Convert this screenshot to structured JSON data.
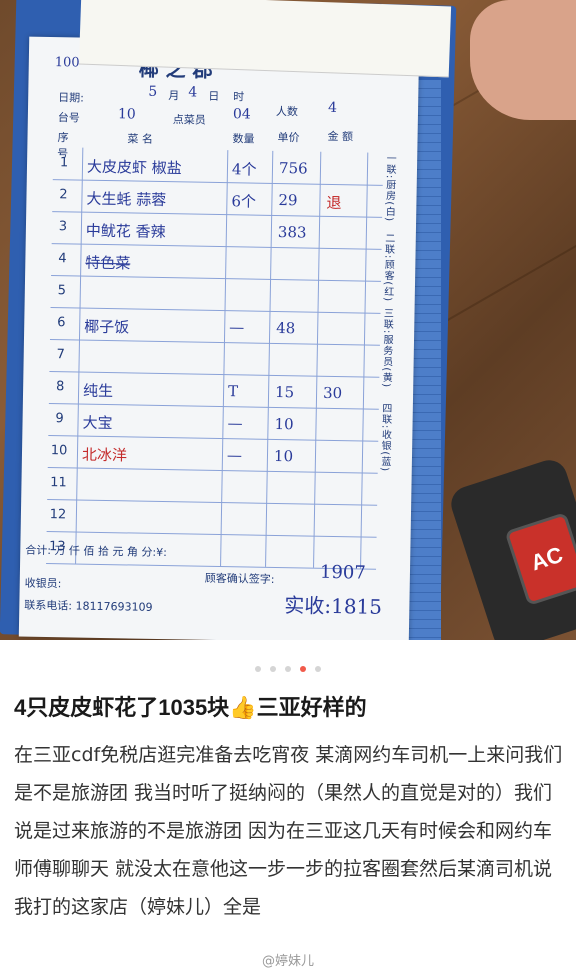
{
  "receipt": {
    "header_numbers": "100",
    "restaurant_title": "椰 之 郡",
    "date_label": "日期:",
    "month": "5",
    "day": "4",
    "month_unit": "月",
    "day_unit": "日",
    "hour_unit": "时",
    "table_label": "台号",
    "table_no": "10",
    "server_label": "点菜员",
    "server_no": "04",
    "guests_label": "人数",
    "guests": "4",
    "col_seq": "序号",
    "col_dish": "菜 名",
    "col_qty": "数量",
    "col_price": "单价",
    "col_amount": "金 额",
    "rows": [
      {
        "n": "1",
        "dish": "大皮皮虾 椒盐",
        "qty": "4个",
        "price": "756",
        "amount": ""
      },
      {
        "n": "2",
        "dish": "大生蚝 蒜蓉",
        "qty": "6个",
        "price": "29",
        "amount": "退"
      },
      {
        "n": "3",
        "dish": "中鱿花 香辣",
        "qty": "",
        "price": "383",
        "amount": ""
      },
      {
        "n": "4",
        "dish": "特色菜",
        "qty": "",
        "price": "",
        "amount": ""
      },
      {
        "n": "5",
        "dish": "",
        "qty": "",
        "price": "",
        "amount": ""
      },
      {
        "n": "6",
        "dish": "椰子饭",
        "qty": "—",
        "price": "48",
        "amount": ""
      },
      {
        "n": "7",
        "dish": "",
        "qty": "",
        "price": "",
        "amount": ""
      },
      {
        "n": "8",
        "dish": "纯生",
        "qty": "T",
        "price": "15",
        "amount": "30"
      },
      {
        "n": "9",
        "dish": "大宝",
        "qty": "—",
        "price": "10",
        "amount": ""
      },
      {
        "n": "10",
        "dish": "北冰洋",
        "qty": "—",
        "price": "10",
        "amount": ""
      },
      {
        "n": "11",
        "dish": "",
        "qty": "",
        "price": "",
        "amount": ""
      },
      {
        "n": "12",
        "dish": "",
        "qty": "",
        "price": "",
        "amount": ""
      },
      {
        "n": "13",
        "dish": "",
        "qty": "",
        "price": "",
        "amount": ""
      }
    ],
    "total_label": "合计:   万   仟   佰   拾   元   角   分:¥:",
    "cashier_label": "收银员:",
    "confirm_label": "顾客确认签字:",
    "phone_label": "联系电话: 18117693109",
    "handwritten_total": "1907",
    "handwritten_paid": "实收:1815",
    "side_labels": [
      "一联:厨房(白)",
      "二联:顾客(红)",
      "三联:服务员(黄)",
      "四联:收银(蓝)"
    ]
  },
  "calculator_key": "AC",
  "pager": {
    "count": 5,
    "active": 3
  },
  "post": {
    "title": "4只皮皮虾花了1035块👍三亚好样的",
    "body": "在三亚cdf免税店逛完准备去吃宵夜 某滴网约车司机一上来问我们是不是旅游团 我当时听了挺纳闷的（果然人的直觉是对的）我们说是过来旅游的不是旅游团 因为在三亚这几天有时候会和网约车师傅聊聊天 就没太在意他这一步一步的拉客圈套然后某滴司机说我打的这家店（婷妹儿）全是",
    "watermark": "@婷妹儿"
  },
  "colors": {
    "ink_blue": "#2a3b9a",
    "ink_red": "#c42b2b",
    "accent_dot": "#f15a4a"
  }
}
